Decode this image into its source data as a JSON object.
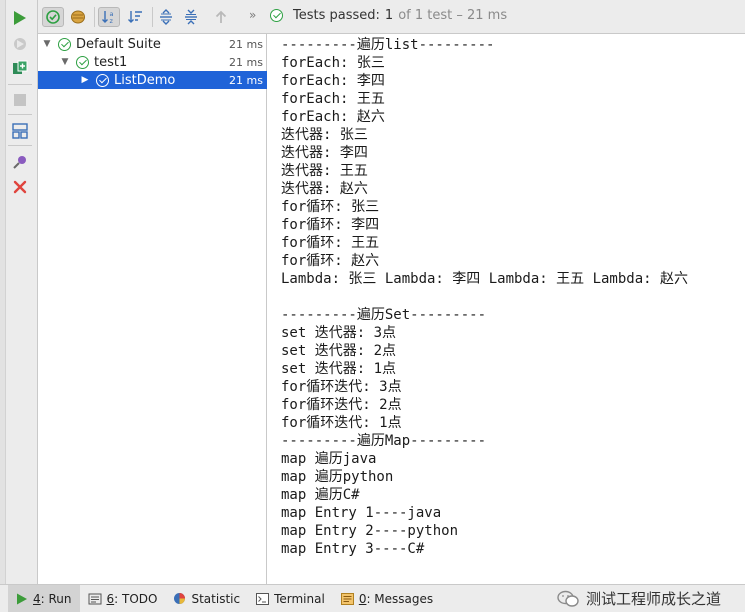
{
  "status": {
    "prefix": "Tests passed:",
    "passed": "1",
    "rest": "of 1 test – 21 ms"
  },
  "tree": {
    "rows": [
      {
        "label": "Default Suite",
        "duration": "21 ms"
      },
      {
        "label": "test1",
        "duration": "21 ms"
      },
      {
        "label": "ListDemo",
        "duration": "21 ms"
      }
    ]
  },
  "console": {
    "lines": [
      "---------遍历list---------",
      "forEach: 张三",
      "forEach: 李四",
      "forEach: 王五",
      "forEach: 赵六",
      "迭代器: 张三",
      "迭代器: 李四",
      "迭代器: 王五",
      "迭代器: 赵六",
      "for循环: 张三",
      "for循环: 李四",
      "for循环: 王五",
      "for循环: 赵六",
      "Lambda: 张三 Lambda: 李四 Lambda: 王五 Lambda: 赵六",
      "",
      "---------遍历Set---------",
      "set 迭代器: 3点",
      "set 迭代器: 2点",
      "set 迭代器: 1点",
      "for循环迭代: 3点",
      "for循环迭代: 2点",
      "for循环迭代: 1点",
      "---------遍历Map---------",
      "map 遍历java",
      "map 遍历python",
      "map 遍历C#",
      "map Entry 1----java",
      "map Entry 2----python",
      "map Entry 3----C#"
    ]
  },
  "bottom_tabs": {
    "run": {
      "key": "4",
      "label": ": Run"
    },
    "todo": {
      "key": "6",
      "label": ": TODO"
    },
    "statistic": {
      "label": "Statistic"
    },
    "terminal": {
      "label": "Terminal"
    },
    "messages": {
      "key": "0",
      "label": ": Messages"
    }
  },
  "watermark": {
    "text": "测试工程师成长之道"
  },
  "colors": {
    "accent_selected": "#1f63d8",
    "pass_green": "#2ea043",
    "stop_red": "#e0443e",
    "run_green": "#3c9c3a"
  },
  "icons": {
    "run": "play-icon",
    "rerun_failed": "rerun-failed-icon",
    "toggle_auto_test": "toggle-auto-test-icon",
    "stop": "stop-icon",
    "layout": "layout-icon",
    "pin": "pin-icon",
    "close": "close-icon",
    "show_passed": "show-passed-icon",
    "show_ignored": "show-ignored-icon",
    "sort_alpha": "sort-alphabetically-icon",
    "sort_duration": "sort-by-duration-icon",
    "expand_all": "expand-all-icon",
    "collapse_all": "collapse-all-icon",
    "prev_failed": "previous-failed-icon",
    "more": "chevron-more-icon"
  }
}
